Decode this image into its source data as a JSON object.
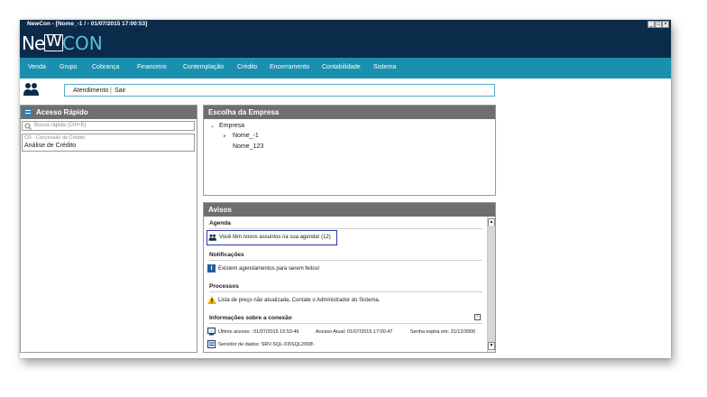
{
  "window": {
    "title": "NewCon - [Nome_-1 / - 01/07/2015 17:00:53]",
    "controls": [
      "_",
      "□",
      "×"
    ]
  },
  "logo": {
    "part1": "Ne",
    "part2": "W",
    "part3": "CON"
  },
  "nav": [
    "Venda",
    "Grupo",
    "Cobrança",
    "Financeiro",
    "Contemplação",
    "Crédito",
    "Encerramento",
    "Contabilidade",
    "Sistema"
  ],
  "toolbar": {
    "atendimento": "Atendimento",
    "sep": "|",
    "sair": "Sair"
  },
  "acesso_rapido": {
    "title": "Acesso Rápido",
    "search_placeholder": "Busca rápida (Ctrl+E)",
    "item_caption": "CR - Concessão de Crédito",
    "item_title": "Análise de Crédito"
  },
  "empresa": {
    "title": "Escolha da Empresa",
    "root": "Empresa",
    "child1": "Nome_-1",
    "child2": "Nome_123"
  },
  "avisos": {
    "title": "Avisos",
    "agenda_title": "Agenda",
    "agenda_msg": "Você têm novos assuntos na sua agenda! (12)",
    "notif_title": "Notificações",
    "notif_msg": "Existem agendamentos para serem feitos!",
    "proc_title": "Processos",
    "proc_msg": "Lista de preço não atualizada. Contate o Administrador do Sistema.",
    "conn_title": "Informações sobre a conexão",
    "ultimo_acesso": "Último acesso : 01/07/2015 15:53:46",
    "acesso_atual": "Acesso Atual: 01/07/2015 17:00:47",
    "senha_expira": "Senha expira em: 31/12/3000",
    "servidor": "Servidor de dados: SRV-SQL-03\\SQL2008\\"
  },
  "colors": {
    "titlebar": "#0d2a4a",
    "header": "#0b2b4b",
    "nav": "#1a8fae",
    "panel_head": "#6f6f6f",
    "highlight": "#2a3a9a"
  }
}
